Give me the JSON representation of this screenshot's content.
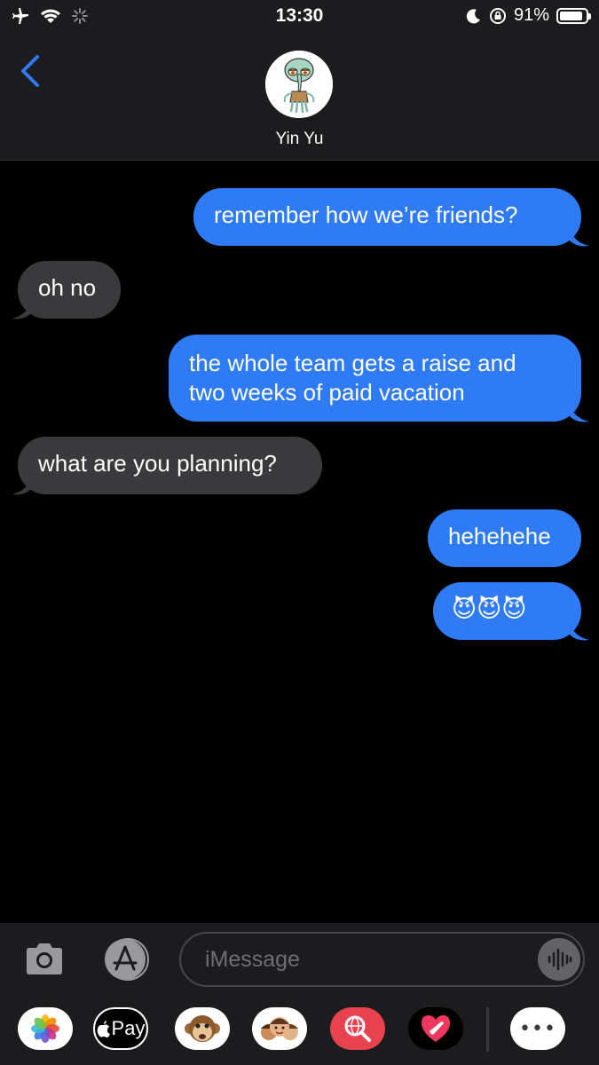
{
  "status_bar": {
    "time": "13:30",
    "battery_percent": "91%",
    "battery_level": 0.91,
    "icons": [
      "airplane-icon",
      "wifi-icon",
      "activity-spinner-icon",
      "moon-icon",
      "orientation-lock-icon",
      "battery-icon"
    ]
  },
  "header": {
    "contact_name": "Yin Yu",
    "back_icon": "chevron-left-icon",
    "accent_color": "#2f7bf5"
  },
  "messages": [
    {
      "sender": "me",
      "text": "remember how we’re friends?"
    },
    {
      "sender": "them",
      "text": "oh no"
    },
    {
      "sender": "me",
      "lines": [
        "the whole team gets a raise and",
        "two weeks of paid vacation"
      ]
    },
    {
      "sender": "them",
      "text": "what are you planning?"
    },
    {
      "sender": "me",
      "text": "hehehehe"
    },
    {
      "sender": "me",
      "text": "😈😈😈"
    }
  ],
  "composer": {
    "placeholder": "iMessage",
    "apple_pay_label": "Pay",
    "apple_glyph": "",
    "more_label": "•••"
  },
  "app_drawer": [
    "photos-icon",
    "apple-pay-icon",
    "animoji-icon",
    "memoji-icon",
    "image-search-icon",
    "digital-touch-icon",
    "more-apps-icon"
  ]
}
